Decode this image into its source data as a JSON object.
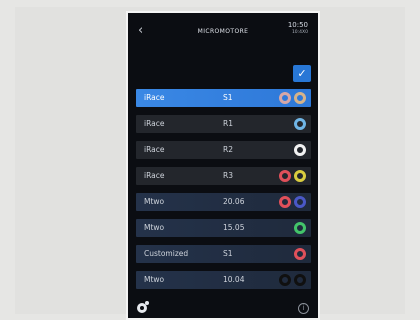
{
  "header": {
    "back_glyph": "‹",
    "title": "MICROMOTORE",
    "time": "10:50",
    "time_sub": "10:4X0"
  },
  "actions": {
    "confirm_glyph": "✓"
  },
  "rows": [
    {
      "name": "iRace",
      "value": "S1",
      "style": "selected",
      "rings": [
        "#d6a7a7",
        "#d6b38a"
      ]
    },
    {
      "name": "iRace",
      "value": "R1",
      "style": "dark",
      "rings": [
        "#6fb5e6"
      ]
    },
    {
      "name": "iRace",
      "value": "R2",
      "style": "dark",
      "rings": [
        "#f2f2f2"
      ]
    },
    {
      "name": "iRace",
      "value": "R3",
      "style": "dark",
      "rings": [
        "#e0505a",
        "#d9cd3f"
      ]
    },
    {
      "name": "Mtwo",
      "value": "20.06",
      "style": "blue",
      "rings": [
        "#e0505a",
        "#4a58c6"
      ]
    },
    {
      "name": "Mtwo",
      "value": "15.05",
      "style": "blue",
      "rings": [
        "#43c46a"
      ]
    },
    {
      "name": "Customized",
      "value": "S1",
      "style": "blue",
      "rings": [
        "#e0505a"
      ]
    },
    {
      "name": "Mtwo",
      "value": "10.04",
      "style": "blue",
      "rings": [
        "#101010",
        "#101010"
      ]
    }
  ],
  "footer": {
    "info_glyph": "i"
  }
}
